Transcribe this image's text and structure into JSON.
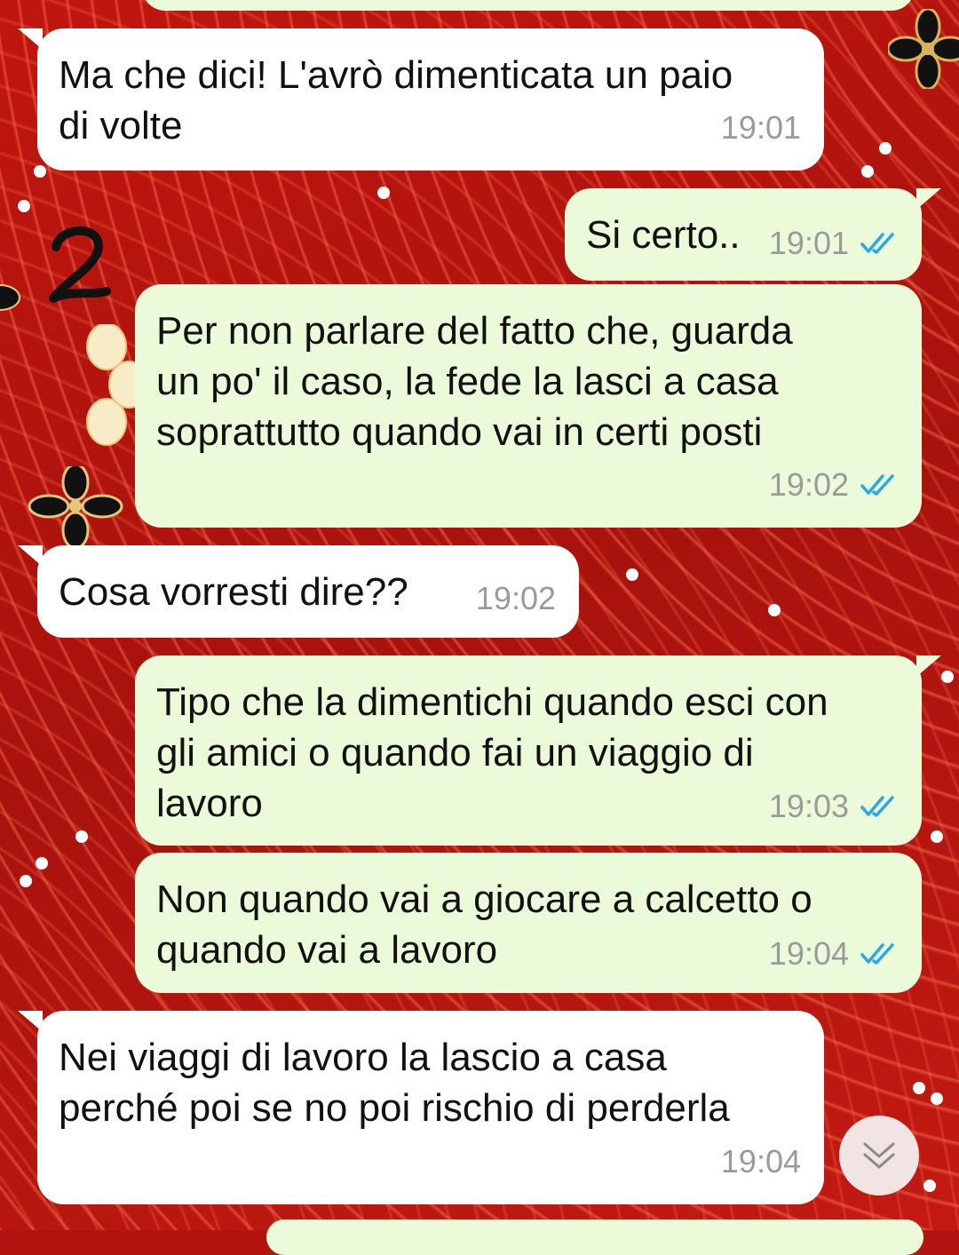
{
  "colors": {
    "background": "#b3140f",
    "incoming_bubble": "#ffffff",
    "outgoing_bubble": "#ebfbd9",
    "timestamp": "#9a9a9a",
    "read_ticks": "#2aa7e6"
  },
  "messages": [
    {
      "direction": "in",
      "text": "Ma che dici! L'avrò dimenticata un paio\ndi volte",
      "time": "19:01"
    },
    {
      "direction": "out",
      "text": "Si certo..",
      "time": "19:01",
      "status_icon": "double-check-read-icon"
    },
    {
      "direction": "out",
      "text": "Per non parlare del fatto che, guarda\nun po' il caso, la fede la lasci a casa\nsoprattutto quando vai in certi posti",
      "time": "19:02",
      "status_icon": "double-check-read-icon"
    },
    {
      "direction": "in",
      "text": "Cosa vorresti dire??",
      "time": "19:02"
    },
    {
      "direction": "out",
      "text": "Tipo che la dimentichi quando esci con\ngli amici o quando fai un viaggio di\nlavoro",
      "time": "19:03",
      "status_icon": "double-check-read-icon"
    },
    {
      "direction": "out",
      "text": "Non quando vai a giocare a calcetto o\nquando vai a lavoro",
      "time": "19:04",
      "status_icon": "double-check-read-icon"
    },
    {
      "direction": "in",
      "text": "Nei viaggi di lavoro la lascio a casa\nperché poi se no poi rischio di perderla",
      "time": "19:04"
    }
  ],
  "annotation": {
    "handwritten_mark": "2"
  },
  "scroll_button": {
    "icon": "double-chevron-down-icon"
  }
}
